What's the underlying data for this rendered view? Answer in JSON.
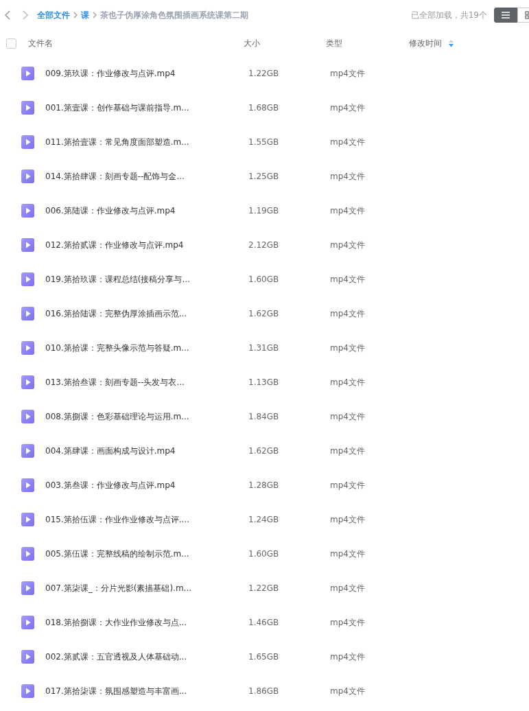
{
  "breadcrumb": [
    {
      "label": "全部文件",
      "kind": "link"
    },
    {
      "label": "课",
      "kind": "link"
    },
    {
      "label": "茶也子伪厚涂角色氛围插画系统课第二期",
      "kind": "current"
    }
  ],
  "load_status": "已全部加载，共19个",
  "view_toggle": [
    {
      "selected": true,
      "kind": "list"
    },
    {
      "selected": false,
      "kind": "grid"
    }
  ],
  "select_all": {
    "checked": false
  },
  "columns": {
    "name": "文件名",
    "size": "大小",
    "type": "类型",
    "modified": "修改时间"
  },
  "files": [
    {
      "name": "009.第玖课：作业修改与点评.mp4",
      "size": "1.22GB",
      "type": "mp4文件"
    },
    {
      "name": "001.第壹课：创作基础与课前指导.m...",
      "size": "1.68GB",
      "type": "mp4文件"
    },
    {
      "name": "011.第拾壹课：常见角度面部塑造.m...",
      "size": "1.55GB",
      "type": "mp4文件"
    },
    {
      "name": "014.第拾肆课：刻画专题--配饰与金...",
      "size": "1.25GB",
      "type": "mp4文件"
    },
    {
      "name": "006.第陆课：作业修改与点评.mp4",
      "size": "1.19GB",
      "type": "mp4文件"
    },
    {
      "name": "012.第拾贰课：作业修改与点评.mp4",
      "size": "2.12GB",
      "type": "mp4文件"
    },
    {
      "name": "019.第拾玖课：课程总结(接稿分享与...",
      "size": "1.60GB",
      "type": "mp4文件"
    },
    {
      "name": "016.第拾陆课：完整伪厚涂插画示范...",
      "size": "1.62GB",
      "type": "mp4文件"
    },
    {
      "name": "010.第拾课：完整头像示范与答疑.m...",
      "size": "1.31GB",
      "type": "mp4文件"
    },
    {
      "name": "013.第拾叁课：刻画专题--头发与衣...",
      "size": "1.13GB",
      "type": "mp4文件"
    },
    {
      "name": "008.第捌课：色彩基础理论与运用.m...",
      "size": "1.84GB",
      "type": "mp4文件"
    },
    {
      "name": "004.第肆课：画面构成与设计.mp4",
      "size": "1.62GB",
      "type": "mp4文件"
    },
    {
      "name": "003.第叁课：作业修改与点评.mp4",
      "size": "1.28GB",
      "type": "mp4文件"
    },
    {
      "name": "015.第拾伍课：作业作业修改与点评....",
      "size": "1.24GB",
      "type": "mp4文件"
    },
    {
      "name": "005.第伍课：完整线稿的绘制示范.m...",
      "size": "1.60GB",
      "type": "mp4文件"
    },
    {
      "name": "007.第柒课_：分片光影(素描基础).m...",
      "size": "1.22GB",
      "type": "mp4文件"
    },
    {
      "name": "018.第拾捌课：大作业作业修改与点...",
      "size": "1.46GB",
      "type": "mp4文件"
    },
    {
      "name": "002.第贰课：五官透视及人体基础动...",
      "size": "1.65GB",
      "type": "mp4文件"
    },
    {
      "name": "017.第拾柒课：氛围感塑造与丰富画...",
      "size": "1.86GB",
      "type": "mp4文件"
    }
  ]
}
